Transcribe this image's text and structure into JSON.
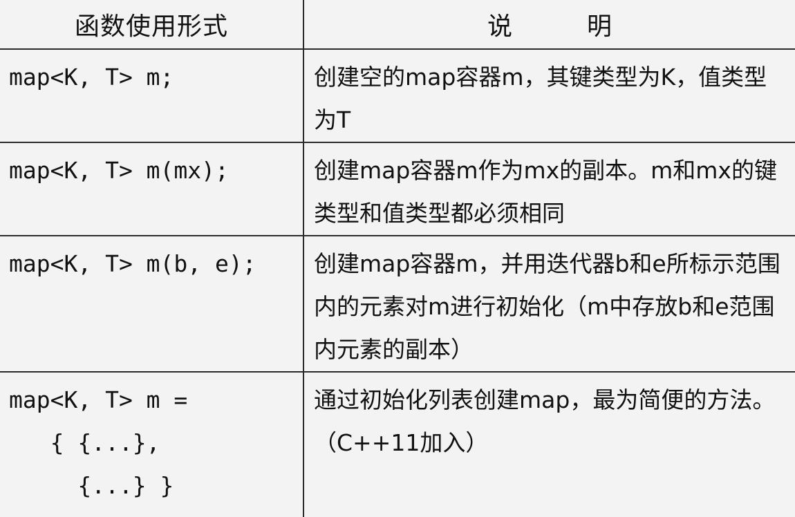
{
  "header": {
    "col1": "函数使用形式",
    "col2": "说　　　明"
  },
  "rows": [
    {
      "code": "map<K, T> m;",
      "desc": "创建空的map容器m，其键类型为K，值类型为T"
    },
    {
      "code": "map<K, T> m(mx);",
      "desc": "创建map容器m作为mx的副本。m和mx的键类型和值类型都必须相同"
    },
    {
      "code": "map<K, T> m(b, e);",
      "desc": "创建map容器m，并用迭代器b和e所标示范围内的元素对m进行初始化（m中存放b和e范围内元素的副本）"
    },
    {
      "code_lines": [
        "map<K, T> m =",
        "   { {...},",
        "     {...} }"
      ],
      "desc": "通过初始化列表创建map，最为简便的方法。（C++11加入）"
    }
  ]
}
